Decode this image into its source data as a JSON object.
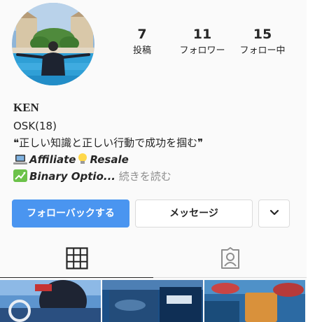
{
  "profile": {
    "username": "KEN",
    "stats": [
      {
        "value": "7",
        "label": "投稿"
      },
      {
        "value": "11",
        "label": "フォロワー"
      },
      {
        "value": "15",
        "label": "フォロー中"
      }
    ],
    "bio": {
      "line1": "OSK(18)",
      "quote_open": "❝",
      "line2": "正しい知識と正しい行動で成功を掴む",
      "quote_close": "❞",
      "line3_a": "Affiliate",
      "line3_b": "Resale",
      "line4": "Binary Optio...",
      "read_more": "続きを読む",
      "emoji_icons": [
        "laptop-icon",
        "lightbulb-icon",
        "chart-up-icon"
      ]
    }
  },
  "actions": {
    "follow_back": "フォローバックする",
    "message": "メッセージ",
    "more_icon": "chevron-down-icon"
  },
  "tabs": [
    {
      "icon": "grid-icon",
      "active": true
    },
    {
      "icon": "tagged-person-icon",
      "active": false
    }
  ],
  "colors": {
    "accent": "#4a95f0",
    "text": "#262626",
    "muted": "#8e8e8e",
    "border": "#dbdbdb"
  }
}
